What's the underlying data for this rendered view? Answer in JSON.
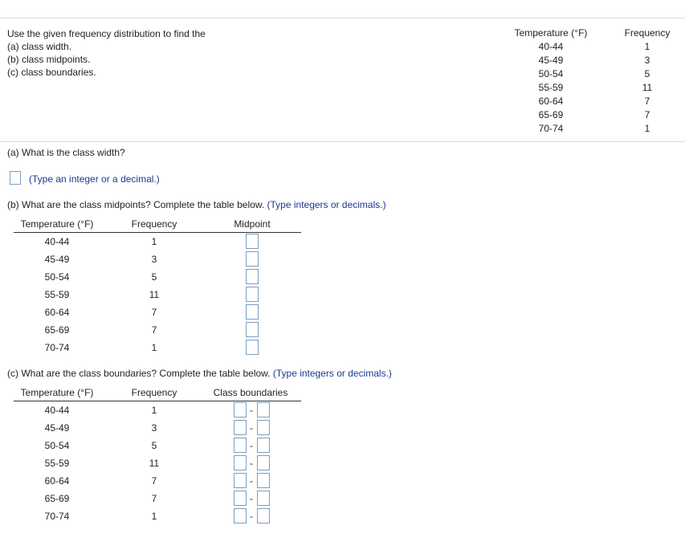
{
  "instructions": {
    "lines": [
      "Use the given frequency distribution to find the",
      "(a) class width.",
      "(b) class midpoints.",
      "(c) class boundaries."
    ]
  },
  "given_table": {
    "col_temp_header": "Temperature (°F)",
    "col_freq_header": "Frequency",
    "rows": [
      {
        "temp": "40-44",
        "freq": "1"
      },
      {
        "temp": "45-49",
        "freq": "3"
      },
      {
        "temp": "50-54",
        "freq": "5"
      },
      {
        "temp": "55-59",
        "freq": "11"
      },
      {
        "temp": "60-64",
        "freq": "7"
      },
      {
        "temp": "65-69",
        "freq": "7"
      },
      {
        "temp": "70-74",
        "freq": "1"
      }
    ]
  },
  "part_a": {
    "question": "(a) What is the class width?",
    "hint": "(Type an integer or a decimal.)"
  },
  "part_b": {
    "question": "(b) What are the class midpoints? Complete the table below.",
    "hint": "(Type integers or decimals.)",
    "col_temp": "Temperature (°F)",
    "col_freq": "Frequency",
    "col_mid": "Midpoint"
  },
  "part_c": {
    "question": "(c) What are the class boundaries? Complete the table below.",
    "hint": "(Type integers or decimals.)",
    "col_temp": "Temperature (°F)",
    "col_freq": "Frequency",
    "col_bounds": "Class boundaries",
    "separator": "-"
  }
}
